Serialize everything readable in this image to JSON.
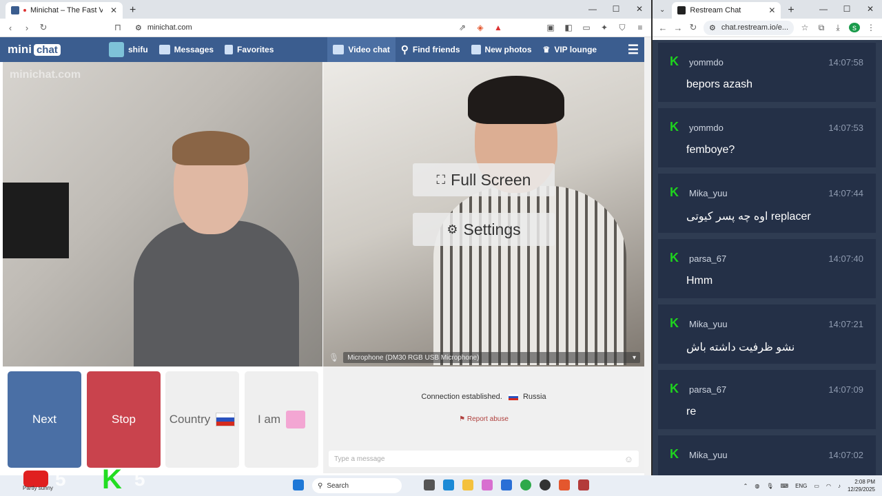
{
  "left_browser": {
    "tab_title": "Minichat – The Fast Video Ch",
    "url": "minichat.com"
  },
  "minichat": {
    "logo_mini": "mini",
    "logo_chat": "chat",
    "user": "shifu",
    "nav": [
      "Messages",
      "Favorites",
      "Video chat",
      "Find friends",
      "New photos",
      "VIP lounge"
    ],
    "watermark": "minichat.com",
    "full_screen": "Full Screen",
    "settings": "Settings",
    "microphone": "Microphone (DM30 RGB USB Microphone)",
    "buttons": {
      "next": "Next",
      "stop": "Stop",
      "country": "Country",
      "iam": "I am"
    },
    "connection": "Connection established.",
    "country_name": "Russia",
    "report": "Report abuse",
    "message_placeholder": "Type a message"
  },
  "right_browser": {
    "tab_title": "Restream Chat",
    "url": "chat.restream.io/e..."
  },
  "chat": [
    {
      "user": "yommdo",
      "time": "14:07:58",
      "text": "bepors azash"
    },
    {
      "user": "yommdo",
      "time": "14:07:53",
      "text": "femboye?"
    },
    {
      "user": "Mika_yuu",
      "time": "14:07:44",
      "text": "اوه چه پسر کیوتی replacer"
    },
    {
      "user": "parsa_67",
      "time": "14:07:40",
      "text": "Hmm"
    },
    {
      "user": "Mika_yuu",
      "time": "14:07:21",
      "text": "نشو ظرفیت داشته باش"
    },
    {
      "user": "parsa_67",
      "time": "14:07:09",
      "text": "re"
    },
    {
      "user": "Mika_yuu",
      "time": "14:07:02",
      "text": ""
    }
  ],
  "taskbar": {
    "weather": "Partly sunny",
    "search": "Search",
    "lang": "ENG",
    "time": "2:08 PM",
    "date": "12/29/2025",
    "overlay_num_1": "5",
    "overlay_num_2": "5"
  },
  "colors": {
    "nav": "#3b5d8f",
    "next": "#4a6fa5",
    "stop": "#c9434d",
    "chat_bg": "#2f3c52",
    "kick_green": "#1ed31e"
  }
}
